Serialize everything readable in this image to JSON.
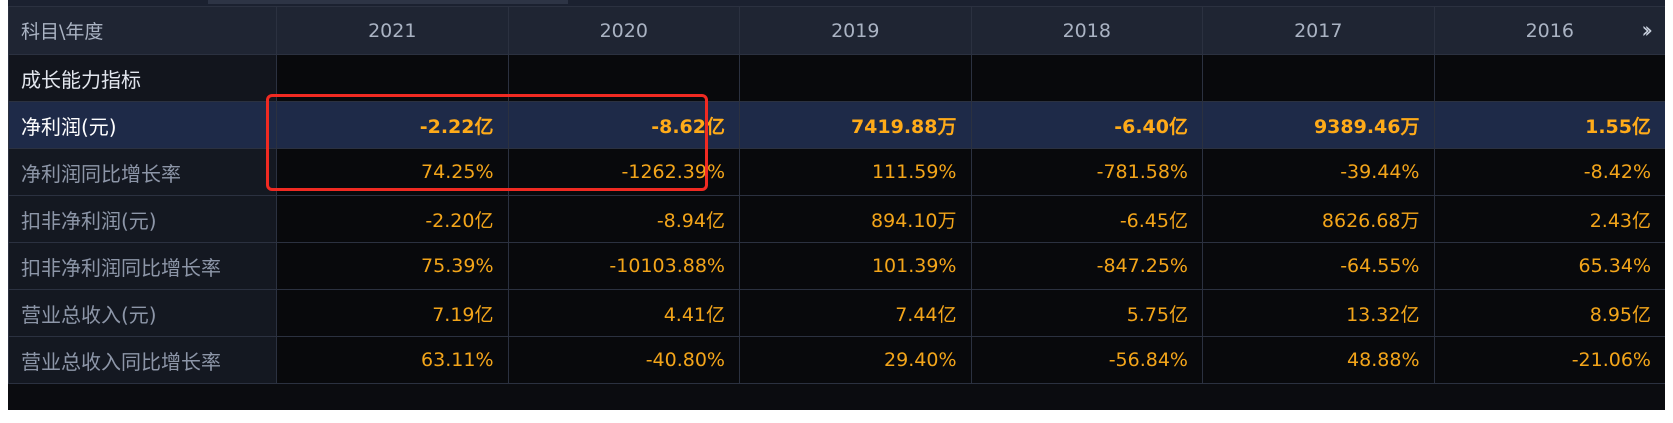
{
  "header": {
    "corner_label": "科目\\年度",
    "years": [
      "2021",
      "2020",
      "2019",
      "2018",
      "2017",
      "2016"
    ],
    "more_icon": "double-chevron-right-icon"
  },
  "rows": [
    {
      "label": "成长能力指标",
      "values": [
        "",
        "",
        "",
        "",
        "",
        ""
      ]
    },
    {
      "label": "净利润(元)",
      "values": [
        "-2.22亿",
        "-8.62亿",
        "7419.88万",
        "-6.40亿",
        "9389.46万",
        "1.55亿"
      ]
    },
    {
      "label": "净利润同比增长率",
      "values": [
        "74.25%",
        "-1262.39%",
        "111.59%",
        "-781.58%",
        "-39.44%",
        "-8.42%"
      ]
    },
    {
      "label": "扣非净利润(元)",
      "values": [
        "-2.20亿",
        "-8.94亿",
        "894.10万",
        "-6.45亿",
        "8626.68万",
        "2.43亿"
      ]
    },
    {
      "label": "扣非净利润同比增长率",
      "values": [
        "75.39%",
        "-10103.88%",
        "101.39%",
        "-847.25%",
        "-64.55%",
        "65.34%"
      ]
    },
    {
      "label": "营业总收入(元)",
      "values": [
        "7.19亿",
        "4.41亿",
        "7.44亿",
        "5.75亿",
        "13.32亿",
        "8.95亿"
      ]
    },
    {
      "label": "营业总收入同比增长率",
      "values": [
        "63.11%",
        "-40.80%",
        "29.40%",
        "-56.84%",
        "48.88%",
        "-21.06%"
      ]
    }
  ],
  "colors": {
    "value_text": "#f3a51a",
    "highlight_row_bg": "#1e2a48",
    "annotation_box": "#f02a22"
  }
}
